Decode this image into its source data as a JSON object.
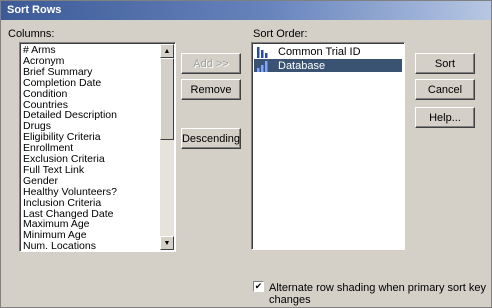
{
  "title": "Sort Rows",
  "columns_label": "Columns:",
  "sort_order_label": "Sort Order:",
  "columns": [
    "# Arms",
    "Acronym",
    "Brief Summary",
    "Completion Date",
    "Condition",
    "Countries",
    "Detailed Description",
    "Drugs",
    "Eligibility Criteria",
    "Enrollment",
    "Exclusion Criteria",
    "Full Text Link",
    "Gender",
    "Healthy Volunteers?",
    "Inclusion Criteria",
    "Last Changed Date",
    "Maximum Age",
    "Minimum Age",
    "Num. Locations"
  ],
  "sort_order": [
    {
      "label": "Common Trial ID",
      "icon": "sort-descending-icon",
      "selected": false
    },
    {
      "label": "Database",
      "icon": "sort-ascending-icon",
      "selected": true
    }
  ],
  "buttons": {
    "add": "Add >>",
    "remove": "Remove",
    "descending": "Descending",
    "sort": "Sort",
    "cancel": "Cancel",
    "help": "Help..."
  },
  "alternate_shading": {
    "label": "Alternate row shading when primary sort key changes",
    "checked": true
  },
  "colors": {
    "title_bar": "#3c5a96",
    "selection": "#3a5373",
    "sort_icon": "#2a4aa8"
  }
}
